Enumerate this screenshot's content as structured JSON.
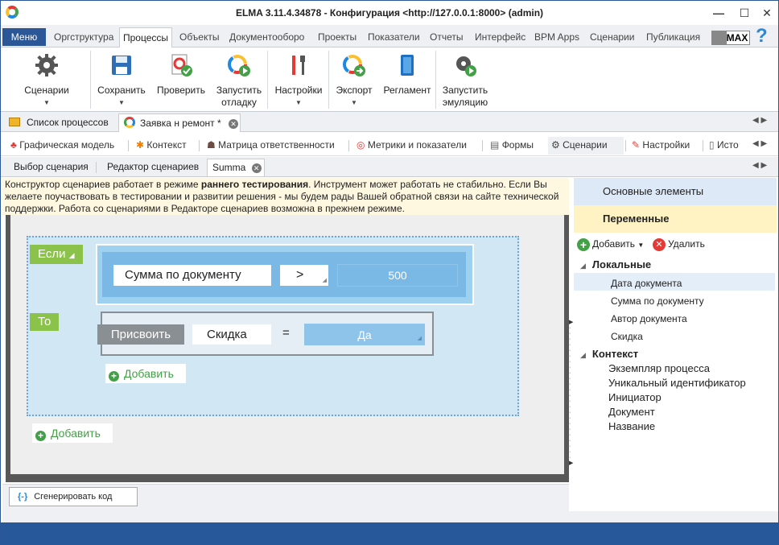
{
  "window": {
    "title": "ELMA 3.11.4.34878 - Конфигурация <http://127.0.0.1:8000> (admin)"
  },
  "menubar": {
    "menu_label": "Меню",
    "tabs": [
      "Оргструктура",
      "Процессы",
      "Объекты",
      "Документооборо",
      "Проекты",
      "Показатели",
      "Отчеты",
      "Интерфейс",
      "BPM Apps",
      "Сценарии",
      "Публикация"
    ],
    "active_tab": "Процессы",
    "max_label": "MAX",
    "help": "?"
  },
  "ribbon": {
    "scenarios": "Сценарии",
    "save": "Сохранить",
    "check": "Проверить",
    "run_debug_1": "Запустить",
    "run_debug_2": "отладку",
    "settings": "Настройки",
    "export": "Экспорт",
    "regulation": "Регламент",
    "run_emul_1": "Запустить",
    "run_emul_2": "эмуляцию"
  },
  "doctabs": {
    "list": "Список процессов",
    "active": "Заявка н ремонт *"
  },
  "subtabs": [
    "Графическая модель",
    "Контекст",
    "Матрица ответственности",
    "Метрики и показатели",
    "Формы",
    "Сценарии",
    "Настройки",
    "Исто"
  ],
  "active_subtab": "Сценарии",
  "editortabs": {
    "select": "Выбор сценария",
    "editor": "Редактор сценариев",
    "active": "Summa"
  },
  "warning": {
    "pre": "Конструктор сценариев работает в режиме ",
    "bold": "раннего тестирования",
    "post": ". Инструмент может работать не стабильно. Если Вы желаете поучаствовать в тестировании и развитии решения - мы будем рады Вашей обратной связи на сайте технической поддержки. Работа со сценариями в Редакторе сценариев возможна в прежнем режиме."
  },
  "canvas": {
    "if_label": "Если",
    "then_label": "То",
    "condition": {
      "left": "Сумма по документу",
      "operator": ">",
      "value": "500"
    },
    "action": {
      "type": "Присвоить",
      "target": "Скидка",
      "operator": "=",
      "value": "Да"
    },
    "inner_add": "Добавить",
    "outer_add": "Добавить"
  },
  "bottom": {
    "generate": "Сгенерировать код"
  },
  "right_panel": {
    "basic": "Основные элементы",
    "variables": "Переменные",
    "add": "Добавить",
    "delete": "Удалить",
    "local_header": "Локальные",
    "local_items": [
      "Дата документа",
      "Сумма по документу",
      "Автор документа",
      "Скидка"
    ],
    "context_header": "Контекст",
    "context_items": [
      "Экземпляр процесса",
      "Уникальный идентификатор",
      "Инициатор",
      "Документ",
      "Название"
    ]
  },
  "colors": {
    "brand": "#2b5797",
    "accent_green": "#8bc34a",
    "block_blue": "#7ab8e6",
    "highlight": "#fff3c4"
  }
}
